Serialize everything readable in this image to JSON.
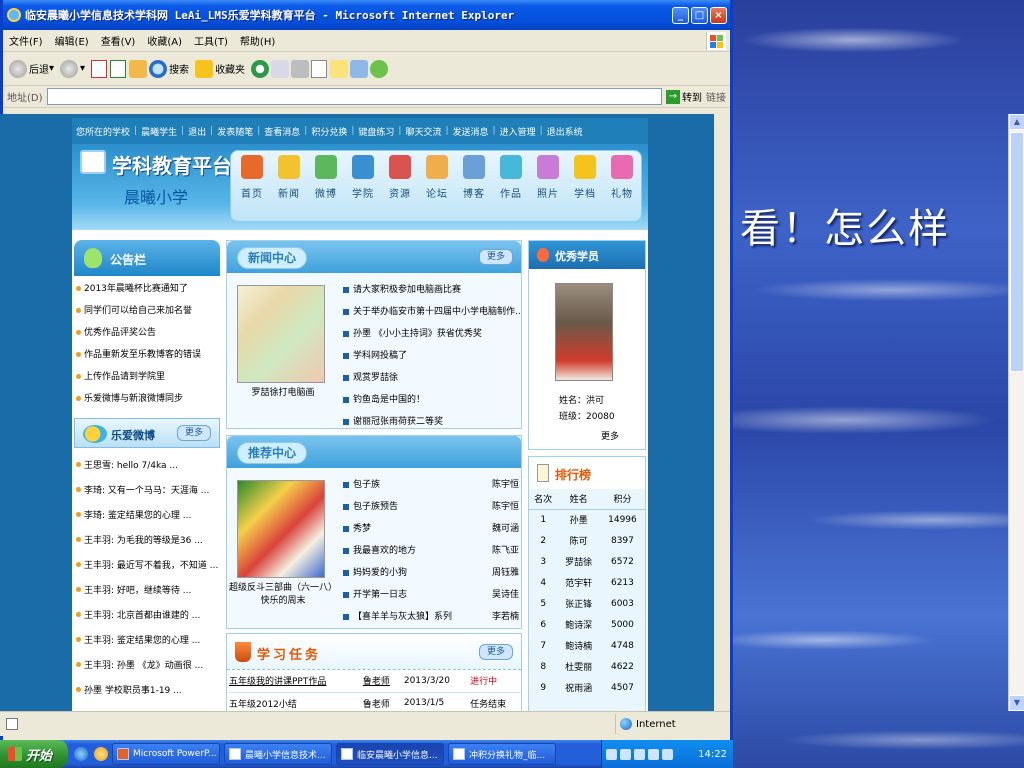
{
  "slide": {
    "caption": "看！怎么样"
  },
  "window": {
    "title": "临安晨曦小学信息技术学科网 LeAi_LMS乐爱学科教育平台 - Microsoft Internet Explorer",
    "menu": [
      "文件(F)",
      "编辑(E)",
      "查看(V)",
      "收藏(A)",
      "工具(T)",
      "帮助(H)"
    ],
    "toolbar": {
      "back": "后退",
      "search": "搜索",
      "favorites": "收藏夹"
    },
    "address": {
      "label": "地址(D)",
      "value": "",
      "go": "转到",
      "links": "链接"
    },
    "status": {
      "zone": "Internet"
    }
  },
  "site": {
    "top_nav": [
      "您所在的学校",
      "|",
      "晨曦学生",
      "|",
      "退出",
      "|",
      "发表随笔",
      "|",
      "查看消息",
      "|",
      "积分兑换",
      "|",
      "键盘练习",
      "|",
      "聊天交流",
      "|",
      "发送消息",
      "|",
      "进入管理",
      "|",
      "退出系统"
    ],
    "logo_title": "学科教育平台",
    "school_name": "晨曦小学",
    "nav_tabs": [
      "首页",
      "新闻",
      "微博",
      "学院",
      "资源",
      "论坛",
      "博客",
      "作品",
      "照片",
      "学档",
      "礼物"
    ],
    "notice": {
      "title": "公告栏",
      "items": [
        "2013年晨曦杯比赛通知了",
        "同学们可以给自己来加名誉",
        "优秀作品评奖公告",
        "作品重新发至乐教博客的错误",
        "上传作品请到学院里",
        "乐爱微博与新浪微博同步"
      ]
    },
    "weibo": {
      "title": "乐爱微博",
      "more": "更多",
      "items": [
        "王思雪: hello 7/4ka ...",
        "李琦: 又有一个马马：天涯海 ...",
        "李琦: 鉴定结果您的心理 ...",
        "王丰羽: 为毛我的等级是36 ...",
        "王丰羽: 最近写不着我，不知道 ...",
        "王丰羽: 好吧，继续等待 ...",
        "王丰羽: 北京首都由谁建的 ...",
        "王丰羽: 鉴定结果您的心理 ...",
        "王丰羽: 孙墨 《龙》动画很 ...",
        "孙墨 学校职员事1-19 ..."
      ]
    },
    "news": {
      "title": "新闻中心",
      "more": "更多",
      "thumb_caption": "罗喆徐打电脑画",
      "items": [
        "请大家积极参加电脑画比赛",
        "关于举办临安市第十四届中小学电脑制作...",
        "孙墨 《小小主持词》获省优秀奖",
        "学科网投稿了",
        "观赏罗喆徐",
        "钓鱼岛是中国的！",
        "谢丽冠张雨荷获二等奖"
      ]
    },
    "recommend": {
      "title": "推荐中心",
      "thumb_caption": "超级反斗三部曲（六一八）快乐的周末",
      "items": [
        {
          "title": "包子族",
          "author": "陈宇恒"
        },
        {
          "title": "包子族预告",
          "author": "陈宇恒"
        },
        {
          "title": "秀梦",
          "author": "魏可涵"
        },
        {
          "title": "我最喜欢的地方",
          "author": "陈飞亚"
        },
        {
          "title": "妈妈爱的小狗",
          "author": "周钰雅"
        },
        {
          "title": "开学第一日志",
          "author": "吴诗佳"
        },
        {
          "title": "【喜羊羊与灰太狼】系列",
          "author": "李若楠"
        }
      ]
    },
    "tasks": {
      "title": "学习任务",
      "more": "更多",
      "rows": [
        {
          "title": "五年级我的讲课PPT作品",
          "teacher": "鲁老师",
          "date": "2013/3/20",
          "status": "进行中"
        },
        {
          "title": "五年级2012小结",
          "teacher": "鲁老师",
          "date": "2013/1/5",
          "status": "任务结束"
        }
      ]
    },
    "star": {
      "title": "优秀学员",
      "name": "姓名：洪可",
      "class": "班级：20080",
      "more": "更多"
    },
    "rank": {
      "title": "排行榜",
      "headers": [
        "名次",
        "姓名",
        "积分"
      ],
      "rows": [
        [
          "1",
          "孙墨",
          "14996"
        ],
        [
          "2",
          "陈可",
          "8397"
        ],
        [
          "3",
          "罗喆徐",
          "6572"
        ],
        [
          "4",
          "范宇轩",
          "6213"
        ],
        [
          "5",
          "张正锋",
          "6003"
        ],
        [
          "6",
          "鲍诗深",
          "5000"
        ],
        [
          "7",
          "鲍诗楠",
          "4748"
        ],
        [
          "8",
          "杜雯丽",
          "4622"
        ],
        [
          "9",
          "祝雨涵",
          "4507"
        ]
      ]
    }
  },
  "taskbar": {
    "start": "开始",
    "tasks": [
      "Microsoft PowerP...",
      "晨曦小学信息技术...",
      "临安晨曦小学信息...",
      "冲积分换礼物_临..."
    ],
    "clock": "14:22"
  }
}
